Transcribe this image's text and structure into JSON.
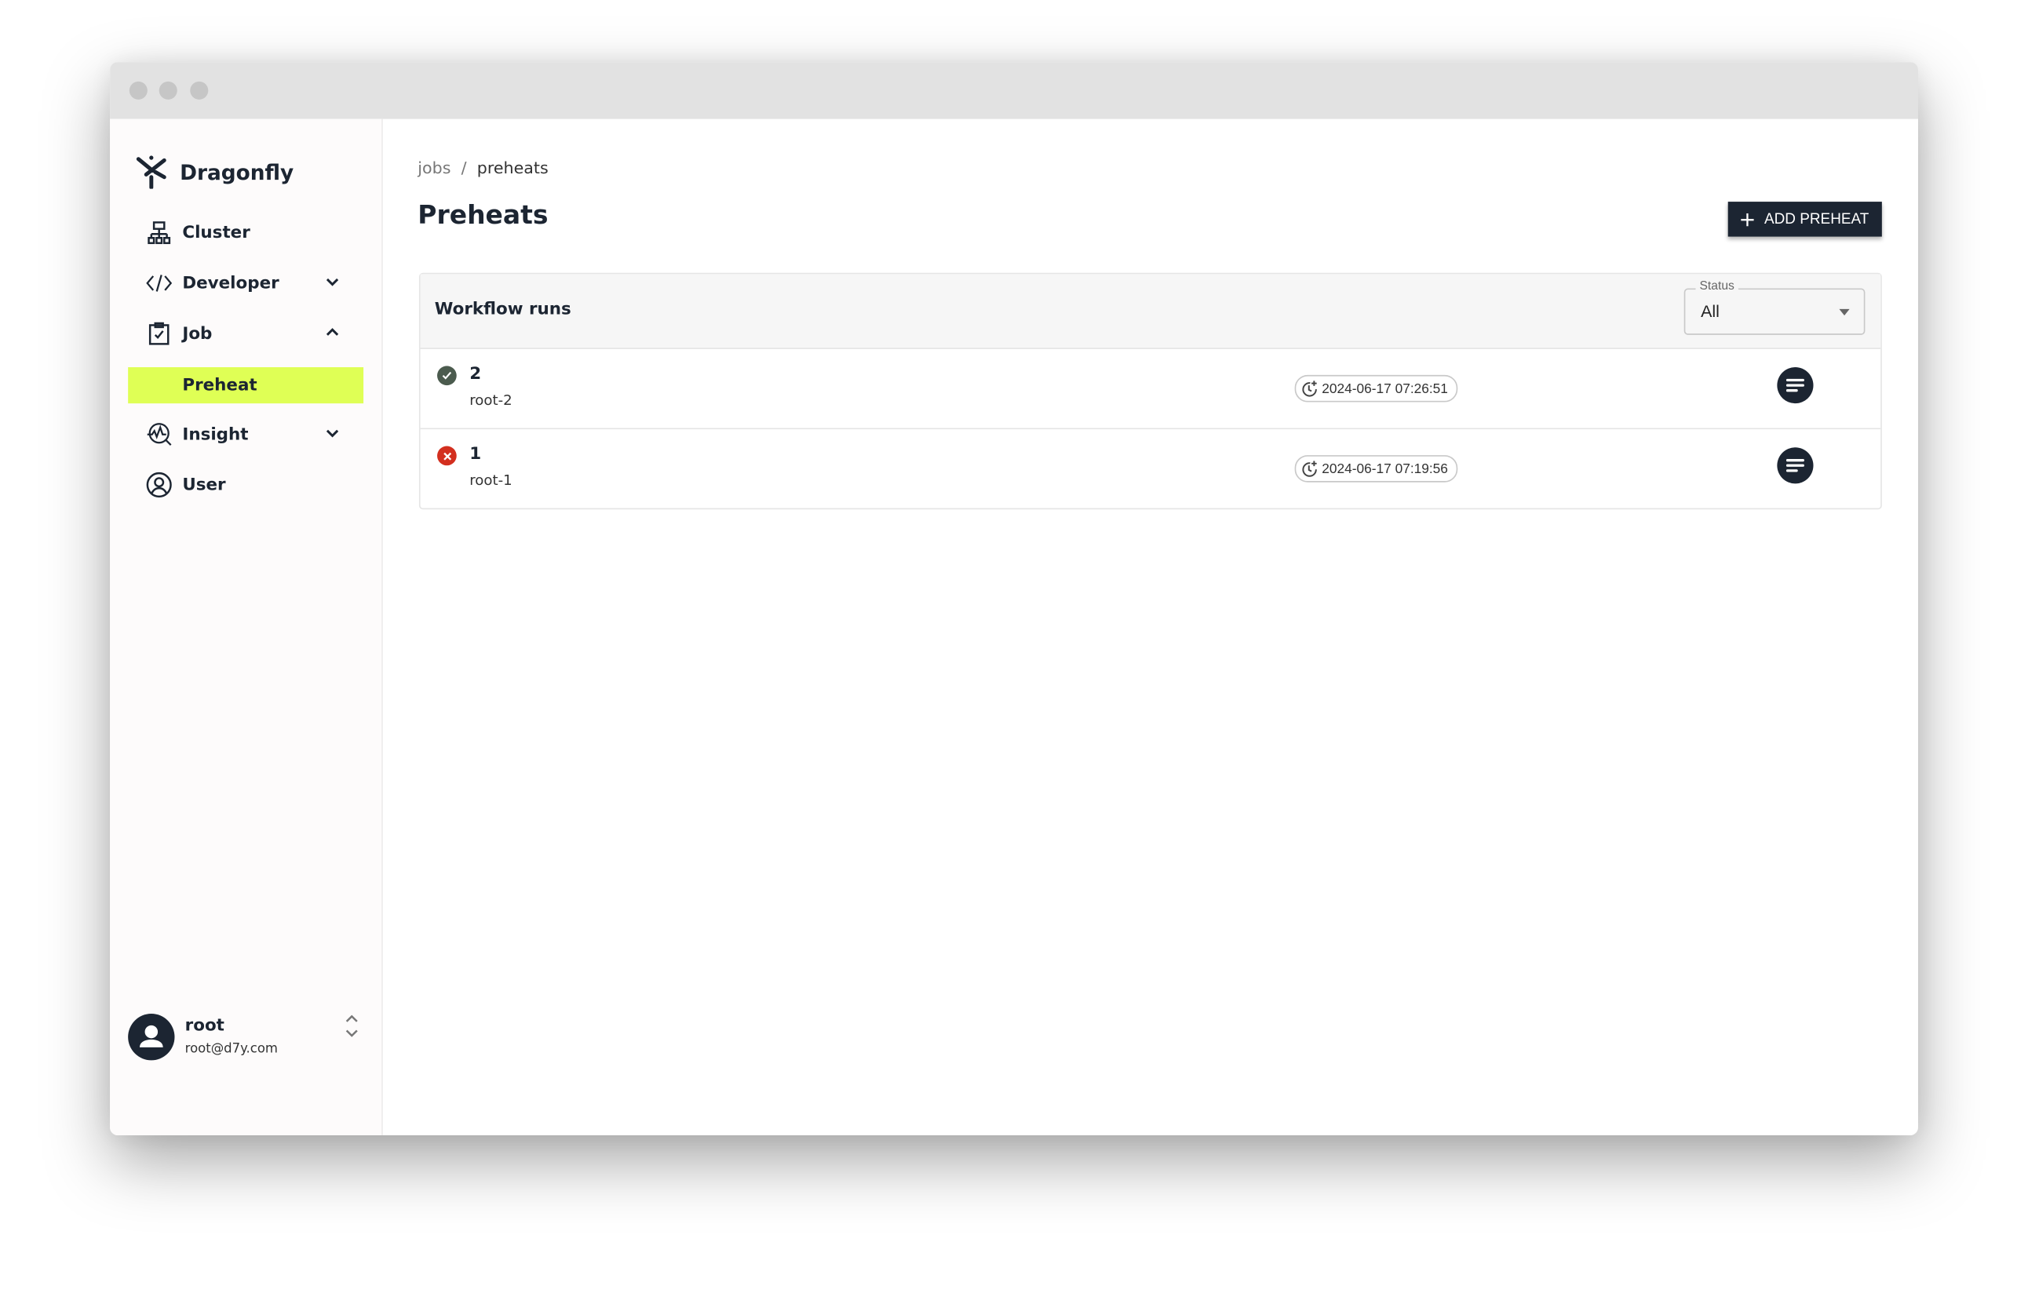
{
  "app": {
    "name": "Dragonfly"
  },
  "sidebar": {
    "items": [
      {
        "label": "Cluster",
        "icon": "cluster-icon"
      },
      {
        "label": "Developer",
        "icon": "code-icon",
        "expanded": false
      },
      {
        "label": "Job",
        "icon": "clipboard-check-icon",
        "expanded": true
      },
      {
        "label": "Preheat",
        "active": true
      },
      {
        "label": "Insight",
        "icon": "insight-icon",
        "expanded": false
      },
      {
        "label": "User",
        "icon": "user-circle-icon"
      }
    ],
    "user": {
      "name": "root",
      "email": "root@d7y.com"
    }
  },
  "breadcrumb": {
    "items": [
      "jobs",
      "preheats"
    ],
    "separator": "/"
  },
  "page": {
    "title": "Preheats",
    "add_button": "ADD PREHEAT"
  },
  "workflow": {
    "title": "Workflow runs",
    "status_filter": {
      "label": "Status",
      "value": "All"
    },
    "runs": [
      {
        "id": "2",
        "name": "root-2",
        "status": "success",
        "created_at": "2024-06-17 07:26:51"
      },
      {
        "id": "1",
        "name": "root-1",
        "status": "failed",
        "created_at": "2024-06-17 07:19:56"
      }
    ]
  },
  "colors": {
    "accent": "#dfff55",
    "dark": "#1c2532",
    "success": "#4b5b4e",
    "failure": "#d32f1f"
  }
}
